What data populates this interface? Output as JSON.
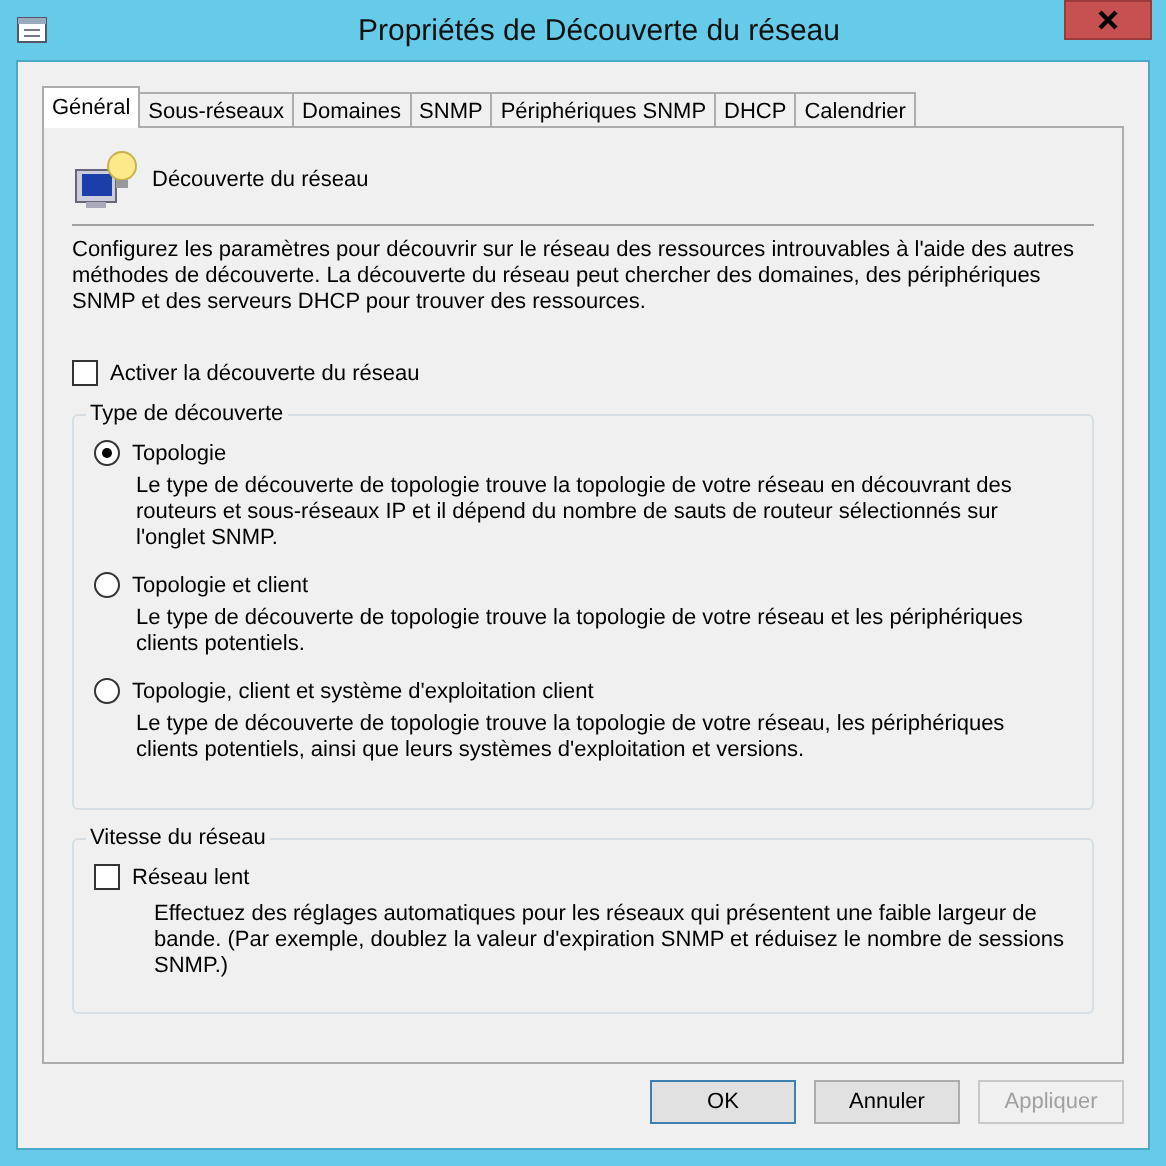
{
  "window": {
    "title": "Propriétés de Découverte du réseau"
  },
  "tabs": [
    {
      "label": "Général",
      "selected": true
    },
    {
      "label": "Sous-réseaux",
      "selected": false
    },
    {
      "label": "Domaines",
      "selected": false
    },
    {
      "label": "SNMP",
      "selected": false
    },
    {
      "label": "Périphériques SNMP",
      "selected": false
    },
    {
      "label": "DHCP",
      "selected": false
    },
    {
      "label": "Calendrier",
      "selected": false
    }
  ],
  "header": {
    "title": "Découverte du réseau"
  },
  "description": "Configurez les paramètres pour découvrir sur le réseau des ressources introuvables à l'aide des autres méthodes de découverte. La découverte du réseau peut chercher des domaines, des périphériques SNMP et des serveurs DHCP pour trouver des ressources.",
  "enable_checkbox": {
    "label": "Activer la découverte du réseau",
    "checked": false
  },
  "discovery_type": {
    "title": "Type de découverte",
    "options": [
      {
        "label": "Topologie",
        "selected": true,
        "description": "Le type de découverte de topologie trouve la topologie de votre réseau en découvrant des routeurs et sous-réseaux IP et il dépend du nombre de sauts de routeur sélectionnés sur l'onglet SNMP."
      },
      {
        "label": "Topologie et client",
        "selected": false,
        "description": "Le type de découverte de topologie trouve la topologie de votre réseau et les périphériques clients potentiels."
      },
      {
        "label": "Topologie, client et système d'exploitation client",
        "selected": false,
        "description": "Le type de découverte de topologie trouve la topologie de votre réseau, les périphériques clients potentiels, ainsi que leurs systèmes d'exploitation et versions."
      }
    ]
  },
  "network_speed": {
    "title": "Vitesse du réseau",
    "checkbox": {
      "label": "Réseau lent",
      "checked": false
    },
    "description": "Effectuez des réglages automatiques pour les réseaux qui présentent une faible largeur de bande. (Par exemple, doublez la valeur d'expiration SNMP et réduisez le nombre de sessions SNMP.)"
  },
  "buttons": [
    {
      "label": "OK",
      "default": true,
      "disabled": false
    },
    {
      "label": "Annuler",
      "default": false,
      "disabled": false
    },
    {
      "label": "Appliquer",
      "default": false,
      "disabled": true
    }
  ]
}
